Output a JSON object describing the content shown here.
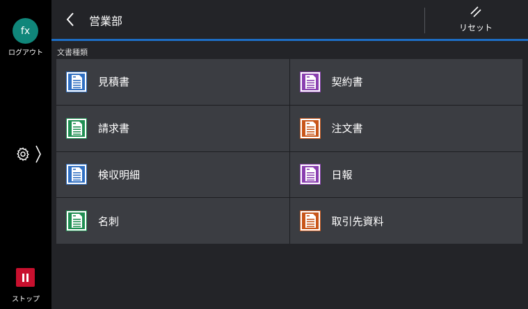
{
  "sidebar": {
    "avatar_text": "fx",
    "logout_label": "ログアウト",
    "stop_label": "ストップ"
  },
  "header": {
    "title": "営業部",
    "reset_label": "リセット"
  },
  "section": {
    "label": "文書種類"
  },
  "doc_types": [
    {
      "label": "見積書",
      "color": "#2f6fc2",
      "icon": "document-icon"
    },
    {
      "label": "契約書",
      "color": "#8a3fb0",
      "icon": "document-icon"
    },
    {
      "label": "請求書",
      "color": "#1f8f52",
      "icon": "document-icon"
    },
    {
      "label": "注文書",
      "color": "#c8561a",
      "icon": "document-icon"
    },
    {
      "label": "検収明細",
      "color": "#2f6fc2",
      "icon": "document-icon"
    },
    {
      "label": "日報",
      "color": "#8a3fb0",
      "icon": "document-icon"
    },
    {
      "label": "名刺",
      "color": "#1f8f52",
      "icon": "document-icon"
    },
    {
      "label": "取引先資料",
      "color": "#c8561a",
      "icon": "document-icon"
    }
  ],
  "colors": {
    "accent": "#1d6ec6",
    "stop": "#c8102e",
    "avatar": "#10867a"
  }
}
